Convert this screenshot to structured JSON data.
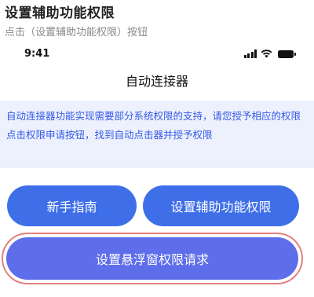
{
  "step": {
    "title": "设置辅助功能权限",
    "instruction": "点击（设置辅助功能权限）按钮"
  },
  "status_bar": {
    "time": "9:41",
    "icons": [
      "signal-icon",
      "wifi-icon",
      "battery-icon"
    ]
  },
  "app": {
    "title": "自动连接器",
    "notice": {
      "line1": "自动连接器功能实现需要部分系统权限的支持，请您授予相应的权限",
      "line2": "点击权限申请按钮，找到自动点击器并授予权限"
    },
    "buttons": {
      "guide": "新手指南",
      "accessibility": "设置辅助功能权限",
      "overlay": "设置悬浮窗权限请求"
    }
  },
  "colors": {
    "primary_button": "#3e6fe8",
    "highlighted_button": "#5e6eea",
    "highlight_ring": "#e3807f",
    "notice_background": "#edf1fd",
    "notice_text": "#3559e6"
  }
}
